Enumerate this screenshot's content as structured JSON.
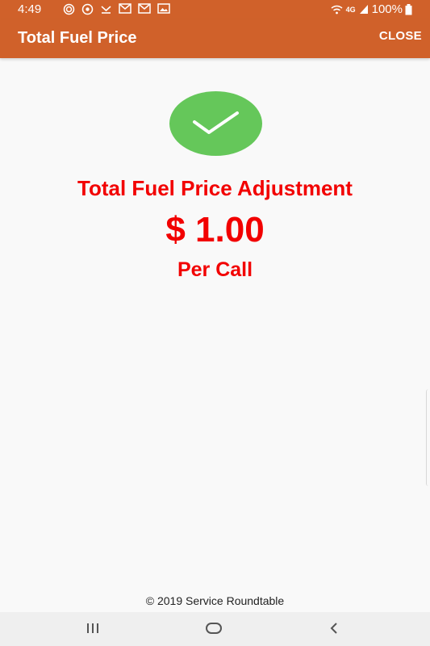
{
  "status_bar": {
    "time": "4:49",
    "network": "4G",
    "battery": "100%"
  },
  "app_bar": {
    "title": "Total Fuel Price",
    "close_label": "CLOSE"
  },
  "result": {
    "headline": "Total Fuel Price Adjustment",
    "amount": "$ 1.00",
    "unit": "Per Call"
  },
  "footer": {
    "copyright": "© 2019 Service Roundtable"
  },
  "colors": {
    "brand_orange": "#d0612a",
    "accent_red": "#f20000",
    "success_green": "#65c75a"
  },
  "icons": {
    "check": "check-icon",
    "nav_recent": "recent-apps-icon",
    "nav_home": "home-icon",
    "nav_back": "back-icon"
  }
}
